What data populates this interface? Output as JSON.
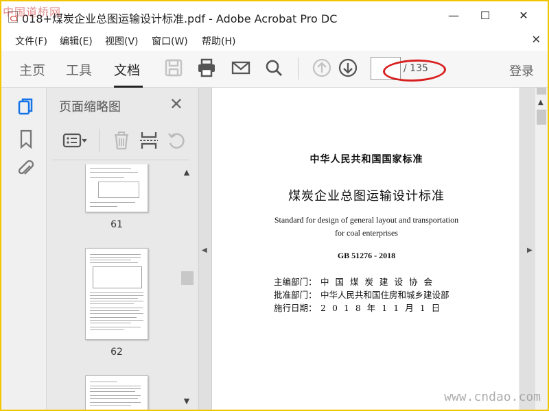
{
  "window": {
    "title": "018+煤炭企业总图运输设计标准.pdf - Adobe Acrobat Pro DC",
    "watermark_top": "中国道桥网",
    "watermark_bottom": "www.cndao.com"
  },
  "menu": [
    "文件(F)",
    "编辑(E)",
    "视图(V)",
    "窗口(W)",
    "帮助(H)"
  ],
  "toolbar": {
    "tabs": [
      "主页",
      "工具",
      "文档"
    ],
    "active_tab": "文档",
    "page_input": "",
    "page_total": "/ 135",
    "login": "登录",
    "highlight_color": "#d81f1f"
  },
  "thumbnails": {
    "panel_title": "页面缩略图",
    "pages": [
      {
        "label": "61"
      },
      {
        "label": "62"
      },
      {
        "label": ""
      }
    ]
  },
  "document": {
    "header": "中华人民共和国国家标准",
    "title": "煤炭企业总图运输设计标准",
    "english_line1": "Standard for design of general layout and transportation",
    "english_line2": "for coal enterprises",
    "code": "GB 51276 - 2018",
    "info": [
      {
        "label": "主编部门：",
        "value": "中国煤炭建设协会"
      },
      {
        "label": "批准部门：",
        "value": "中华人民共和国住房和城乡建设部"
      },
      {
        "label": "施行日期：",
        "value": "2018年11月1日"
      }
    ]
  }
}
